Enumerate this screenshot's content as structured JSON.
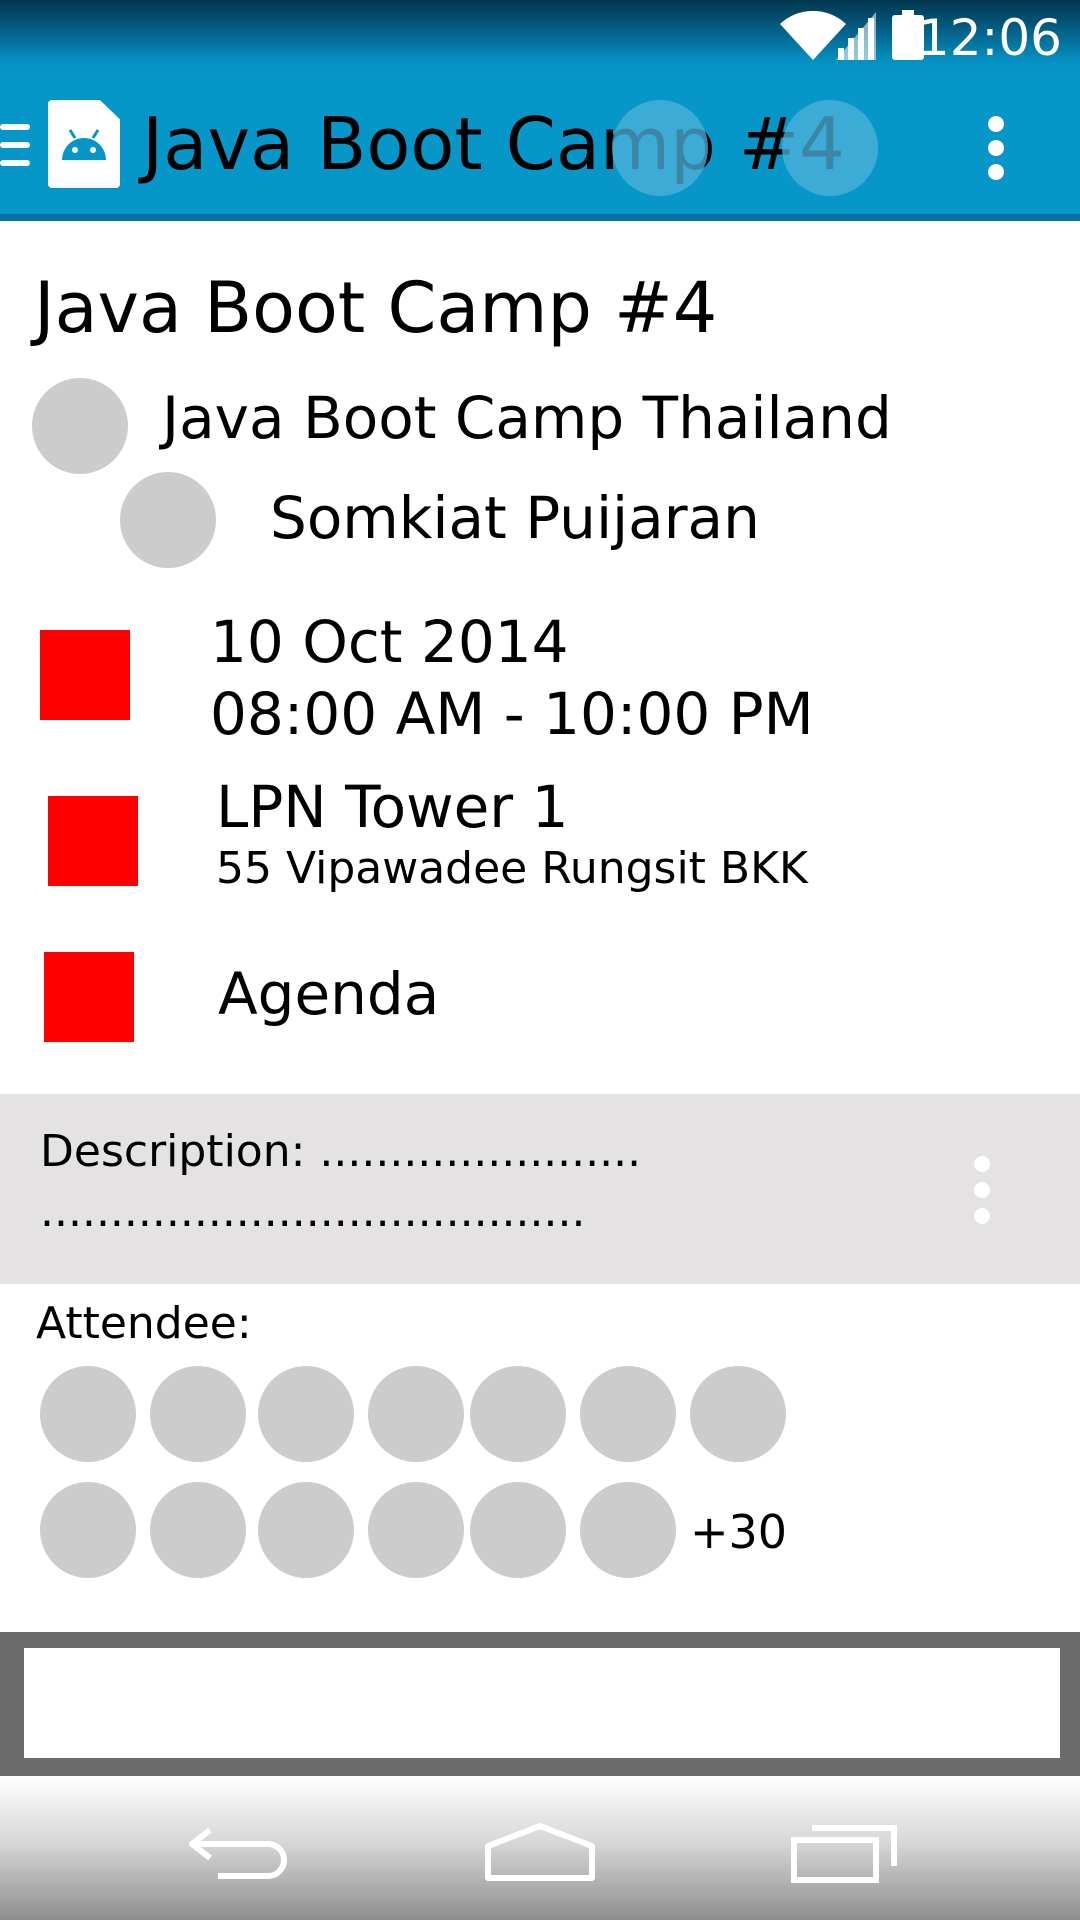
{
  "status_bar": {
    "time": "12:06",
    "icons": [
      "wifi-icon",
      "signal-icon",
      "battery-icon"
    ]
  },
  "app_bar": {
    "title": "Java Boot Camp #4",
    "menu_icon": "menu-icon",
    "app_icon": "android-app-icon",
    "overflow_icon": "overflow-menu-icon"
  },
  "event": {
    "title": "Java Boot Camp #4",
    "organizer": "Java Boot Camp Thailand",
    "host": "Somkiat Puijaran",
    "date": "10 Oct 2014",
    "time": "08:00 AM - 10:00 PM",
    "place_name": "LPN Tower 1",
    "place_address": "55 Vipawadee Rungsit BKK",
    "agenda_label": "Agenda"
  },
  "description": {
    "line1": "Description: .......................",
    "line2": "......................................."
  },
  "attendees": {
    "label": "Attendee:",
    "more_count": "+30"
  },
  "comment_input": {
    "value": "",
    "placeholder": ""
  },
  "nav_bar": {
    "icons": [
      "back-icon",
      "home-icon",
      "recent-apps-icon"
    ]
  },
  "colors": {
    "status_bar": "#0590c2",
    "app_bar": "#0696c8",
    "placeholder_square": "#ff0000",
    "avatar_placeholder": "#cccccc",
    "description_background": "#e4e2e3",
    "input_bar": "#6b6b6b"
  }
}
